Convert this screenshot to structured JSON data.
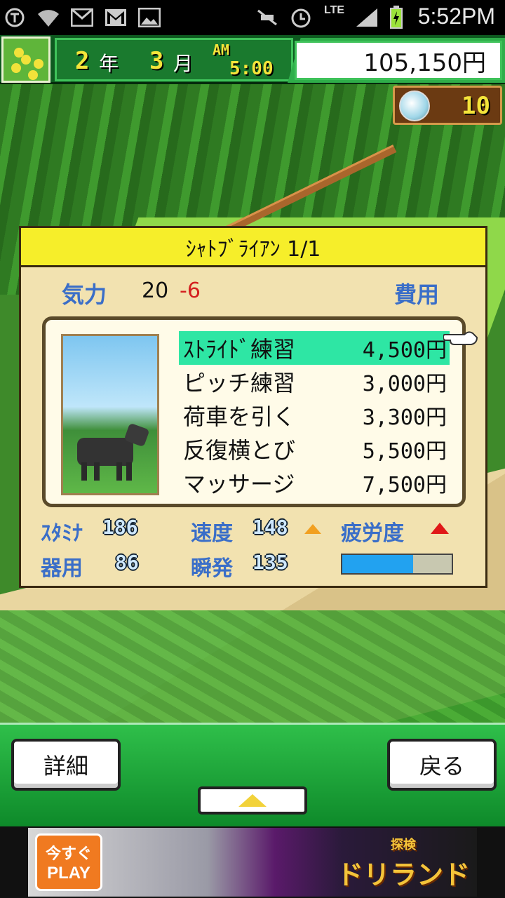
{
  "status_bar": {
    "time": "5:52PM",
    "network": "LTE",
    "icons": [
      "shield-icon",
      "wifi-icon",
      "mail-icon",
      "gmail-icon",
      "image-icon",
      "mute-icon",
      "alarm-icon",
      "signal-icon",
      "battery-charging-icon"
    ]
  },
  "hud": {
    "year": "2",
    "year_unit": "年",
    "month": "3",
    "month_unit": "月",
    "ampm": "AM",
    "clock": "5:00",
    "money": "105,150円"
  },
  "medal": {
    "count": "10"
  },
  "dialog": {
    "title": "ｼｬﾄﾌﾞﾗｲｱﾝ 1/1",
    "kiryoku_label": "気力",
    "kiryoku_value": "20",
    "kiryoku_delta": "-6",
    "cost_label": "費用",
    "menu": [
      {
        "label": "ｽﾄﾗｲﾄﾞ練習",
        "price": "4,500円",
        "selected": true
      },
      {
        "label": "ピッチ練習",
        "price": "3,000円",
        "selected": false
      },
      {
        "label": "荷車を引く",
        "price": "3,300円",
        "selected": false
      },
      {
        "label": "反復横とび",
        "price": "5,500円",
        "selected": false
      },
      {
        "label": "マッサージ",
        "price": "7,500円",
        "selected": false
      }
    ],
    "stats": {
      "stamina_label": "ｽﾀﾐﾅ",
      "stamina_value": "186",
      "speed_label": "速度",
      "speed_value": "148",
      "fatigue_label": "疲労度",
      "dexterity_label": "器用",
      "dexterity_value": "86",
      "burst_label": "瞬発",
      "burst_value": "135",
      "fatigue_level": 0.65
    }
  },
  "bottom": {
    "details_label": "詳細",
    "back_label": "戻る"
  },
  "ad": {
    "play_top": "今すぐ",
    "play_bottom": "PLAY",
    "logo_small": "探検",
    "logo_large": "ドリランド"
  }
}
